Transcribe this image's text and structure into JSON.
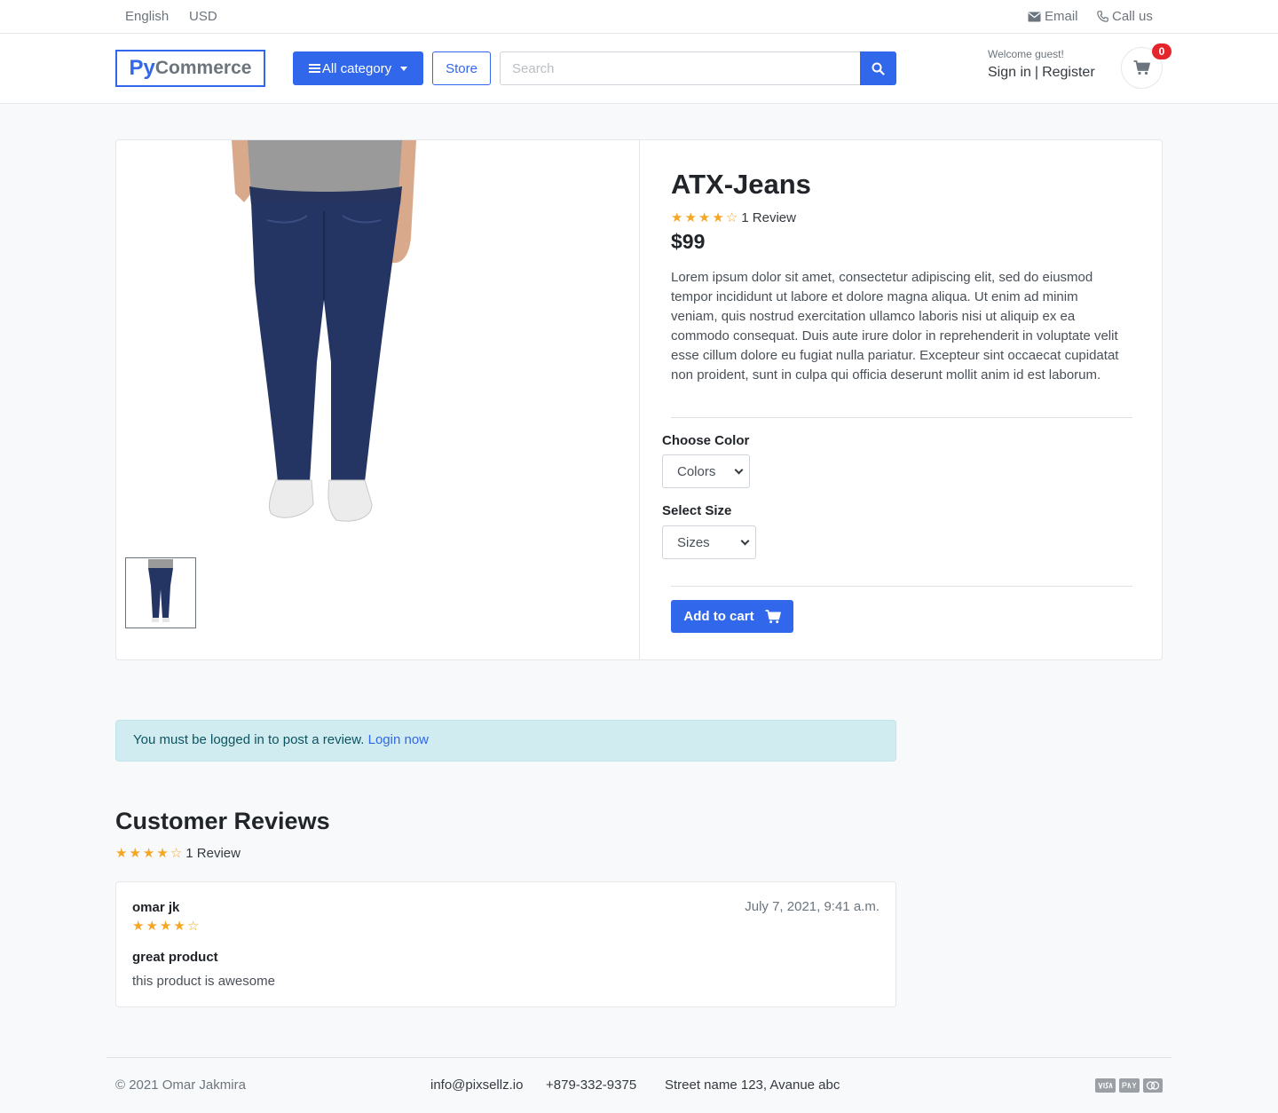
{
  "topbar": {
    "language": "English",
    "currency": "USD",
    "email_label": "Email",
    "call_label": "Call us"
  },
  "header": {
    "logo_py": "Py",
    "logo_commerce": "Commerce",
    "category_button": "All category",
    "store_button": "Store",
    "search_placeholder": "Search",
    "welcome": "Welcome guest!",
    "sign_in": "Sign in",
    "separator": "|",
    "register": "Register",
    "cart_count": "0"
  },
  "product": {
    "title": "ATX-Jeans",
    "rating": 4,
    "rating_max": 5,
    "review_count_label": "1 Review",
    "price": "$99",
    "description": "Lorem ipsum dolor sit amet, consectetur adipiscing elit, sed do eiusmod tempor incididunt ut labore et dolore magna aliqua. Ut enim ad minim veniam, quis nostrud exercitation ullamco laboris nisi ut aliquip ex ea commodo consequat. Duis aute irure dolor in reprehenderit in voluptate velit esse cillum dolore eu fugiat nulla pariatur. Excepteur sint occaecat cupidatat non proident, sunt in culpa qui officia deserunt mollit anim id est laborum.",
    "color_label": "Choose Color",
    "color_value": "Colors",
    "size_label": "Select Size",
    "size_value": "Sizes",
    "add_to_cart": "Add to cart"
  },
  "alert": {
    "text": "You must be logged in to post a review.",
    "link": "Login now"
  },
  "reviews": {
    "title": "Customer Reviews",
    "rating": 4,
    "count_label": "1 Review",
    "items": [
      {
        "author": "omar jk",
        "rating": 4,
        "date": "July 7, 2021, 9:41 a.m.",
        "headline": "great product",
        "body": "this product is awesome"
      }
    ]
  },
  "footer": {
    "copyright": "© 2021 Omar Jakmira",
    "email": "info@pixsellz.io",
    "phone": "+879-332-9375",
    "address": "Street name 123, Avanue abc",
    "payment_icons": [
      "visa-icon",
      "paypal-icon",
      "mastercard-icon"
    ]
  },
  "colors": {
    "primary": "#3167eb",
    "badge": "#e5252c",
    "star": "#f5a623",
    "alert_bg": "#d1ecf1"
  }
}
